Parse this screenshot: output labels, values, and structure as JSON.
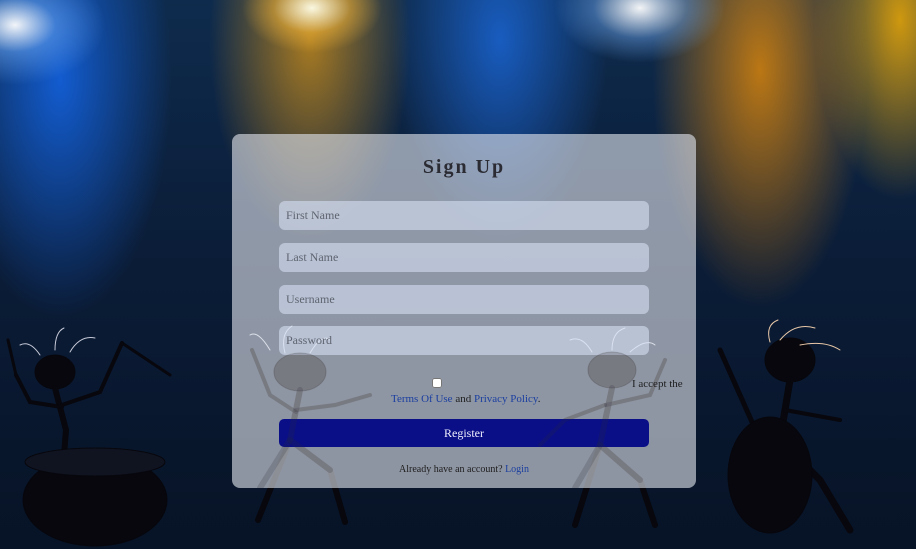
{
  "form": {
    "title": "Sign Up",
    "fields": [
      {
        "placeholder": "First Name"
      },
      {
        "placeholder": "Last Name"
      },
      {
        "placeholder": "Username"
      },
      {
        "placeholder": "Password"
      }
    ],
    "terms": {
      "accept_label": "I accept the",
      "terms_link": "Terms Of Use",
      "and_text": "and",
      "privacy_link": "Privacy Policy",
      "period": "."
    },
    "register_label": "Register",
    "login_prompt": "Already have an account?",
    "login_link": "Login"
  },
  "colors": {
    "register_button": "#0a0f87",
    "link": "#1a3ea0",
    "card_background": "rgba(225,228,236,0.62)"
  }
}
